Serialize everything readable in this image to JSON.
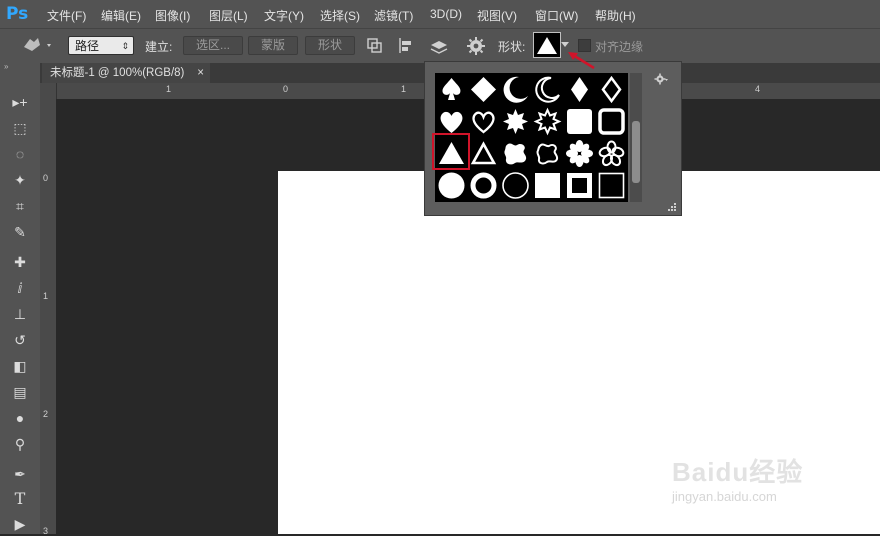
{
  "app": {
    "logo": "Ps"
  },
  "menu": [
    "文件(F)",
    "编辑(E)",
    "图像(I)",
    "图层(L)",
    "文字(Y)",
    "选择(S)",
    "滤镜(T)",
    "3D(D)",
    "视图(V)",
    "窗口(W)",
    "帮助(H)"
  ],
  "options": {
    "mode_value": "路径",
    "make_label": "建立:",
    "selection_label": "选区...",
    "mask_label": "蒙版",
    "shape_label": "形状",
    "shape_picker_label": "形状:",
    "align_edges_label": "对齐边缘"
  },
  "document": {
    "tab_title": "未标题-1 @ 100%(RGB/8)",
    "close_glyph": "×"
  },
  "rulers": {
    "horizontal": [
      "1",
      "0",
      "1",
      "4"
    ],
    "vertical": [
      "0",
      "1",
      "2",
      "3"
    ]
  },
  "shape_popup": {
    "shapes": [
      "spade",
      "diamond",
      "crescent",
      "crescent-outline",
      "diamond-suit",
      "diamond-outline",
      "heart",
      "heart-outline",
      "star-burst",
      "star-burst-outline",
      "rounded-square",
      "rounded-square-outline",
      "triangle",
      "triangle-outline",
      "blob",
      "blob-outline",
      "flower",
      "flower-outline",
      "circle",
      "ring",
      "circle-thin-ring",
      "square",
      "square-frame",
      "square-thin-frame"
    ],
    "selected": "triangle"
  },
  "watermark": {
    "brand": "Baidu经验",
    "url": "jingyan.baidu.com"
  },
  "colors": {
    "accent": "#31a8ff",
    "highlight": "#d0142a",
    "arrow": "#d0142a"
  }
}
